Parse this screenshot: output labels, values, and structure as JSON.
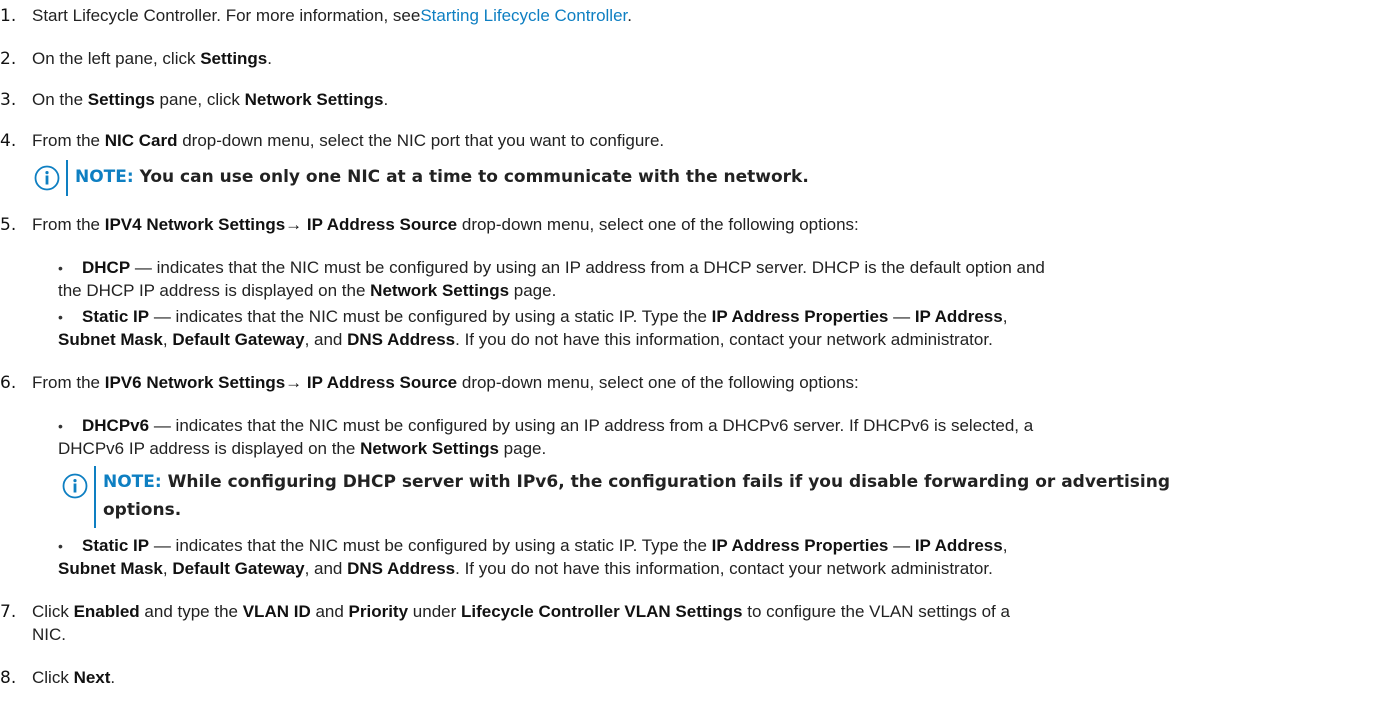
{
  "steps": [
    {
      "num": "1.",
      "pre": "Start Lifecycle Controller. For more information, see",
      "link": "Starting Lifecycle Controller",
      "post": "."
    },
    {
      "num": "2.",
      "a": "On the left pane, click ",
      "b": "Settings",
      "c": "."
    },
    {
      "num": "3.",
      "a": "On the ",
      "b": "Settings",
      "c": " pane, click ",
      "d": "Network Settings",
      "e": "."
    },
    {
      "num": "4.",
      "a": "From the ",
      "b": "NIC Card",
      "c": " drop-down menu, select the NIC port that you want to configure."
    },
    {
      "num": "5.",
      "a": "From the ",
      "b": "IPV4 Network Settings→ IP Address Source",
      "c": " drop-down menu, select one of the following options:"
    },
    {
      "num": "6.",
      "a": "From the ",
      "b": "IPV6 Network Settings→ IP Address Source",
      "c": " drop-down menu, select one of the following options:"
    },
    {
      "num": "7.",
      "a": "Click ",
      "b": "Enabled",
      "c": " and type the ",
      "d": "VLAN ID",
      "e": " and ",
      "f": "Priority",
      "g": " under ",
      "h": "Lifecycle Controller VLAN Settings",
      "i": " to configure the VLAN settings of a",
      "line2": "NIC."
    },
    {
      "num": "8.",
      "a": "Click ",
      "b": "Next",
      "c": "."
    }
  ],
  "notes": {
    "note1": {
      "label": "NOTE:",
      "text": " You can use only one NIC at a time to communicate with the network."
    },
    "note2": {
      "label": "NOTE:",
      "text": " While configuring DHCP server with IPv6, the configuration fails if you disable forwarding or advertising",
      "line2": "options."
    }
  },
  "ipv4_options": {
    "dhcp": {
      "name": "DHCP",
      "l1": " — indicates that the NIC must be configured by using an IP address from a DHCP server. DHCP is the default option and",
      "l2a": "the DHCP IP address is displayed on the ",
      "l2b": "Network Settings",
      "l2c": " page."
    },
    "static": {
      "name": "Static IP",
      "l1a": " — indicates that the NIC must be configured by using a static IP. Type the ",
      "l1b": "IP Address Properties",
      "l1c": " — ",
      "l1d": "IP Address",
      "l1e": ",",
      "l2a": "Subnet Mask",
      "l2b": ", ",
      "l2c": "Default Gateway",
      "l2d": ", and ",
      "l2e": "DNS Address",
      "l2f": ". If you do not have this information, contact your network administrator."
    }
  },
  "ipv6_options": {
    "dhcp": {
      "name": "DHCPv6",
      "l1": " — indicates that the NIC must be configured by using an IP address from a DHCPv6 server. If DHCPv6 is selected, a",
      "l2a": "DHCPv6 IP address is displayed on the ",
      "l2b": "Network Settings",
      "l2c": " page."
    },
    "static": {
      "name": "Static IP",
      "l1a": " — indicates that the NIC must be configured by using a static IP. Type the ",
      "l1b": "IP Address Properties",
      "l1c": " — ",
      "l1d": "IP Address",
      "l1e": ",",
      "l2a": "Subnet Mask",
      "l2b": ", ",
      "l2c": "Default Gateway",
      "l2d": ", and ",
      "l2e": "DNS Address",
      "l2f": ". If you do not have this information, contact your network administrator."
    }
  },
  "bullet": "•",
  "icon": "info-icon",
  "colors": {
    "accent": "#0e7fc2",
    "text": "#222222"
  }
}
